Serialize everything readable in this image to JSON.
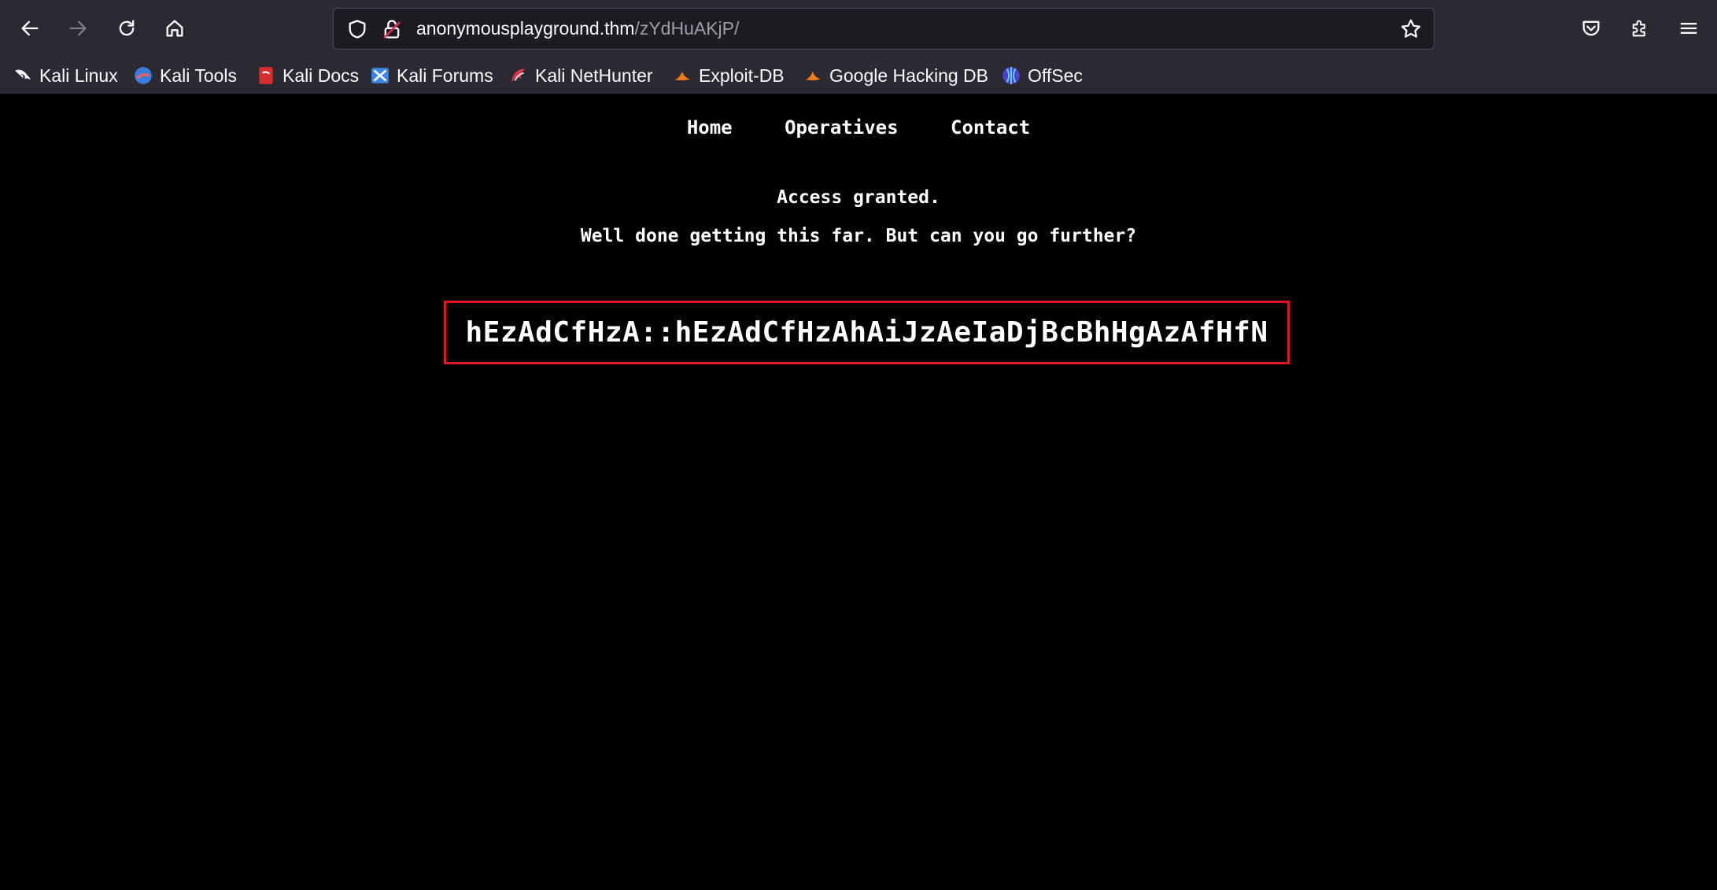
{
  "browser": {
    "url_host": "anonymousplayground.thm",
    "url_path": "/zYdHuAKjP/",
    "bookmarks": [
      {
        "label": "Kali Linux",
        "icon": "kali-dragon-icon"
      },
      {
        "label": "Kali Tools",
        "icon": "kali-tools-icon"
      },
      {
        "label": "Kali Docs",
        "icon": "kali-docs-icon"
      },
      {
        "label": "Kali Forums",
        "icon": "kali-forums-icon"
      },
      {
        "label": "Kali NetHunter",
        "icon": "kali-nethunter-icon"
      },
      {
        "label": "Exploit-DB",
        "icon": "exploit-db-icon"
      },
      {
        "label": "Google Hacking DB",
        "icon": "ghdb-icon"
      },
      {
        "label": "OffSec",
        "icon": "offsec-icon"
      }
    ]
  },
  "site": {
    "nav": [
      "Home",
      "Operatives",
      "Contact"
    ],
    "access_text": "Access granted.",
    "sub_text": "Well done getting this far. But can you go further?",
    "code": "hEzAdCfHzA::hEzAdCfHzAhAiJzAeIaDjBcBhHgAzAfHfN"
  },
  "colors": {
    "highlight_border": "#e0161e",
    "page_background": "#000000",
    "toolbar_background": "#2b2a33"
  }
}
